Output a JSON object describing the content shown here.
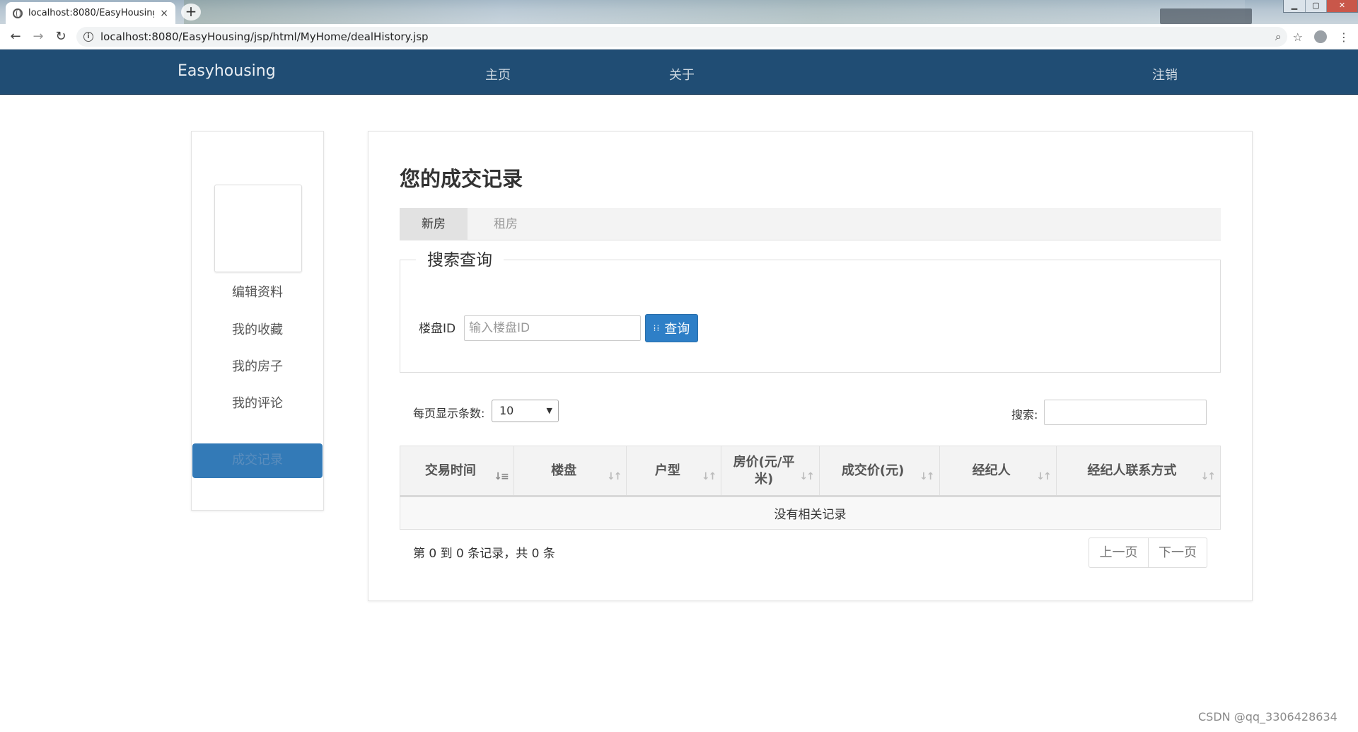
{
  "browser": {
    "tab_title": "localhost:8080/EasyHousing/js",
    "tab_close": "×",
    "new_tab": "+",
    "url": "localhost:8080/EasyHousing/jsp/html/MyHome/dealHistory.jsp",
    "window_controls": [
      "▁",
      "▢",
      "✕"
    ]
  },
  "navbar": {
    "brand": "Easyhousing",
    "links": [
      "主页",
      "关于"
    ],
    "logout": "注销"
  },
  "sidebar": {
    "items": [
      "编辑资料",
      "我的收藏",
      "我的房子",
      "我的评论",
      "成交记录"
    ],
    "active_index": 4
  },
  "main": {
    "title": "您的成交记录",
    "tabs": [
      "新房",
      "租房"
    ],
    "active_tab": 0,
    "search_section": {
      "legend": "搜索查询",
      "field_label": "楼盘ID",
      "field_placeholder": "输入楼盘ID",
      "button_label": "查询"
    },
    "table_controls": {
      "length_label": "每页显示条数:",
      "length_value": "10",
      "search_label": "搜索:"
    },
    "table": {
      "columns": [
        "交易时间",
        "楼盘",
        "户型",
        "房价(元/平米)",
        "成交价(元)",
        "经纪人",
        "经纪人联系方式"
      ],
      "empty_message": "没有相关记录"
    },
    "info": "第 0 到 0 条记录，共 0 条",
    "pager": {
      "prev": "上一页",
      "next": "下一页"
    }
  },
  "watermark": "CSDN @qq_3306428634",
  "colors": {
    "navbar": "#204d74",
    "primary": "#337ab7",
    "button": "#2e7fc7"
  }
}
